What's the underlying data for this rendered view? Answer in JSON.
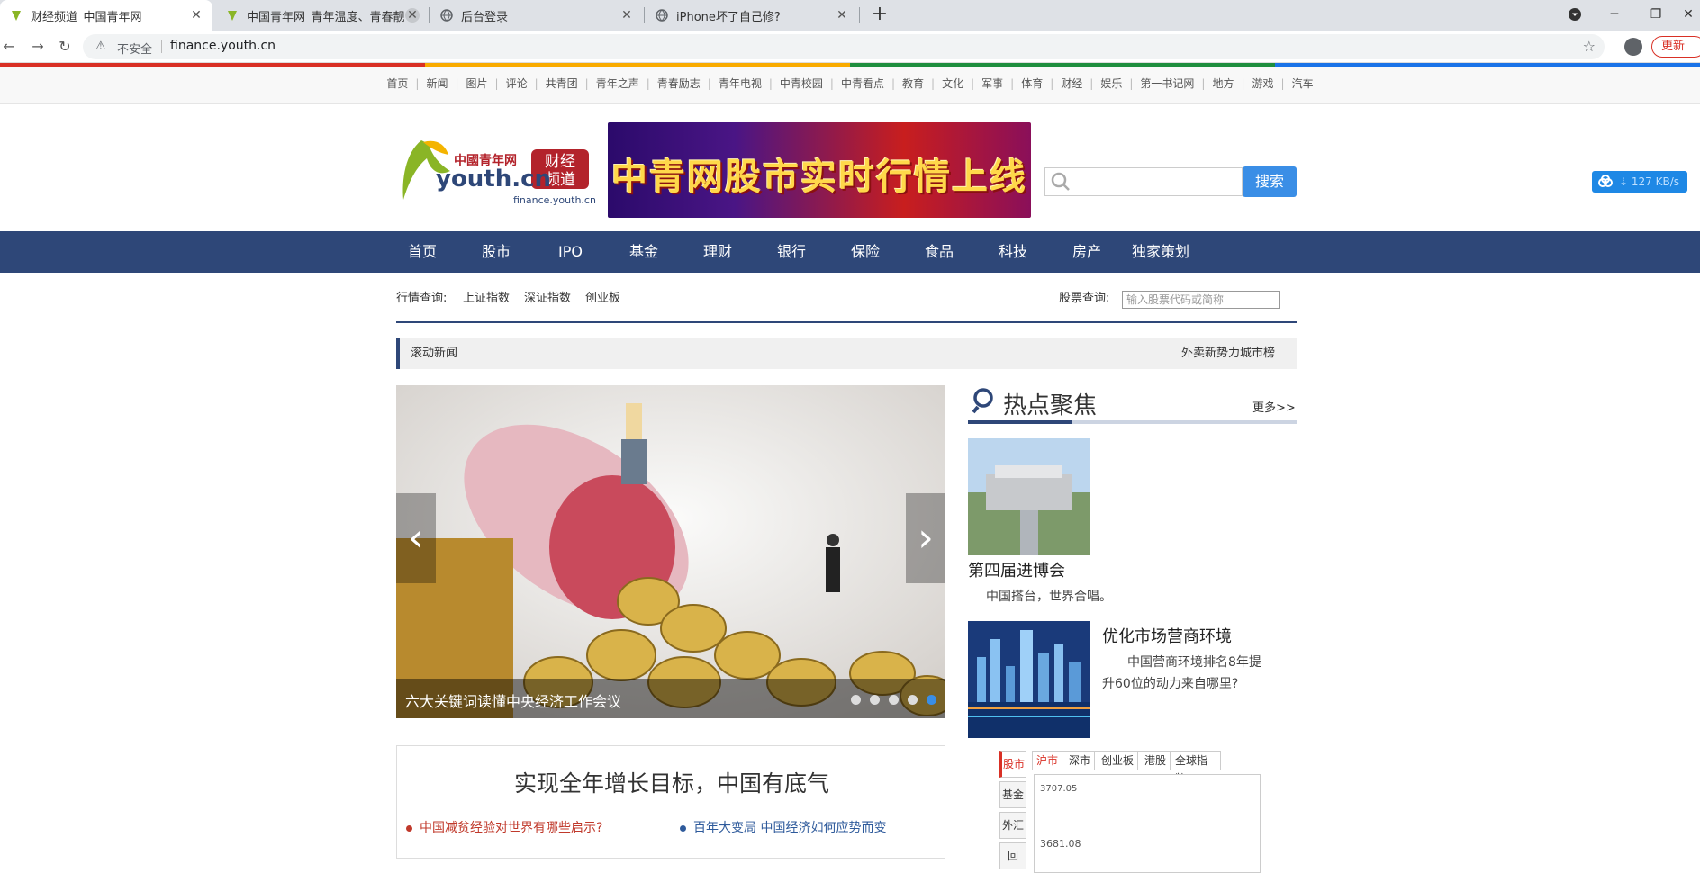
{
  "browser": {
    "tabs": [
      {
        "title": "财经频道_中国青年网",
        "active": true
      },
      {
        "title": "中国青年网_青年温度、青春靓度",
        "active": false
      },
      {
        "title": "后台登录",
        "active": false
      },
      {
        "title": "iPhone坏了自己修?",
        "active": false
      }
    ],
    "address": {
      "security_text": "不安全",
      "url": "finance.youth.cn"
    },
    "update_label": "更新"
  },
  "topnav": [
    "首页",
    "新闻",
    "图片",
    "评论",
    "共青团",
    "青年之声",
    "青春励志",
    "青年电视",
    "中青校园",
    "中青看点",
    "教育",
    "文化",
    "军事",
    "体育",
    "财经",
    "娱乐",
    "第一书记网",
    "地方",
    "游戏",
    "汽车"
  ],
  "header": {
    "logo_text": "中國青年网",
    "logo_domain": "youth.cn",
    "logo_sub": "finance.youth.cn",
    "logo_badge": "财经频道",
    "banner_text": "中青网股市实时行情上线",
    "search_button": "搜索",
    "speed": "127 KB/s"
  },
  "mainnav": [
    "首页",
    "股市",
    "IPO",
    "基金",
    "理财",
    "银行",
    "保险",
    "食品",
    "科技",
    "房产",
    "独家策划"
  ],
  "quotes": {
    "label": "行情查询:",
    "links": [
      "上证指数",
      "深证指数",
      "创业板"
    ],
    "stock_label": "股票查询:",
    "stock_placeholder": "输入股票代码或简称"
  },
  "ticker": {
    "label": "滚动新闻",
    "news": "外卖新势力城市榜"
  },
  "slider": {
    "caption": "六大关键词读懂中央经济工作会议",
    "dots": 5,
    "active_dot": 4
  },
  "headline": {
    "title": "实现全年增长目标，中国有底气",
    "links": [
      {
        "text": "中国减贫经验对世界有哪些启示?",
        "color": "#c0392b"
      },
      {
        "text": "百年大变局 中国经济如何应势而变",
        "color": "#2e5a9b"
      }
    ]
  },
  "hot": {
    "title": "热点聚焦",
    "more": "更多>>",
    "items": [
      {
        "title": "第四届进博会",
        "desc": "中国搭台，世界合唱。"
      },
      {
        "title": "优化市场营商环境",
        "desc": "中国营商环境排名8年提升60位的动力来自哪里?"
      }
    ]
  },
  "stock_widget": {
    "side": [
      "股市",
      "基金",
      "外汇",
      "回"
    ],
    "tabs": [
      "沪市",
      "深市",
      "创业板",
      "港股",
      "全球指数"
    ],
    "values": [
      "3707.05",
      "3681.08"
    ]
  },
  "colors": {
    "nav_bg": "#2e4778",
    "accent": "#3a8ee6",
    "red": "#d93025"
  }
}
